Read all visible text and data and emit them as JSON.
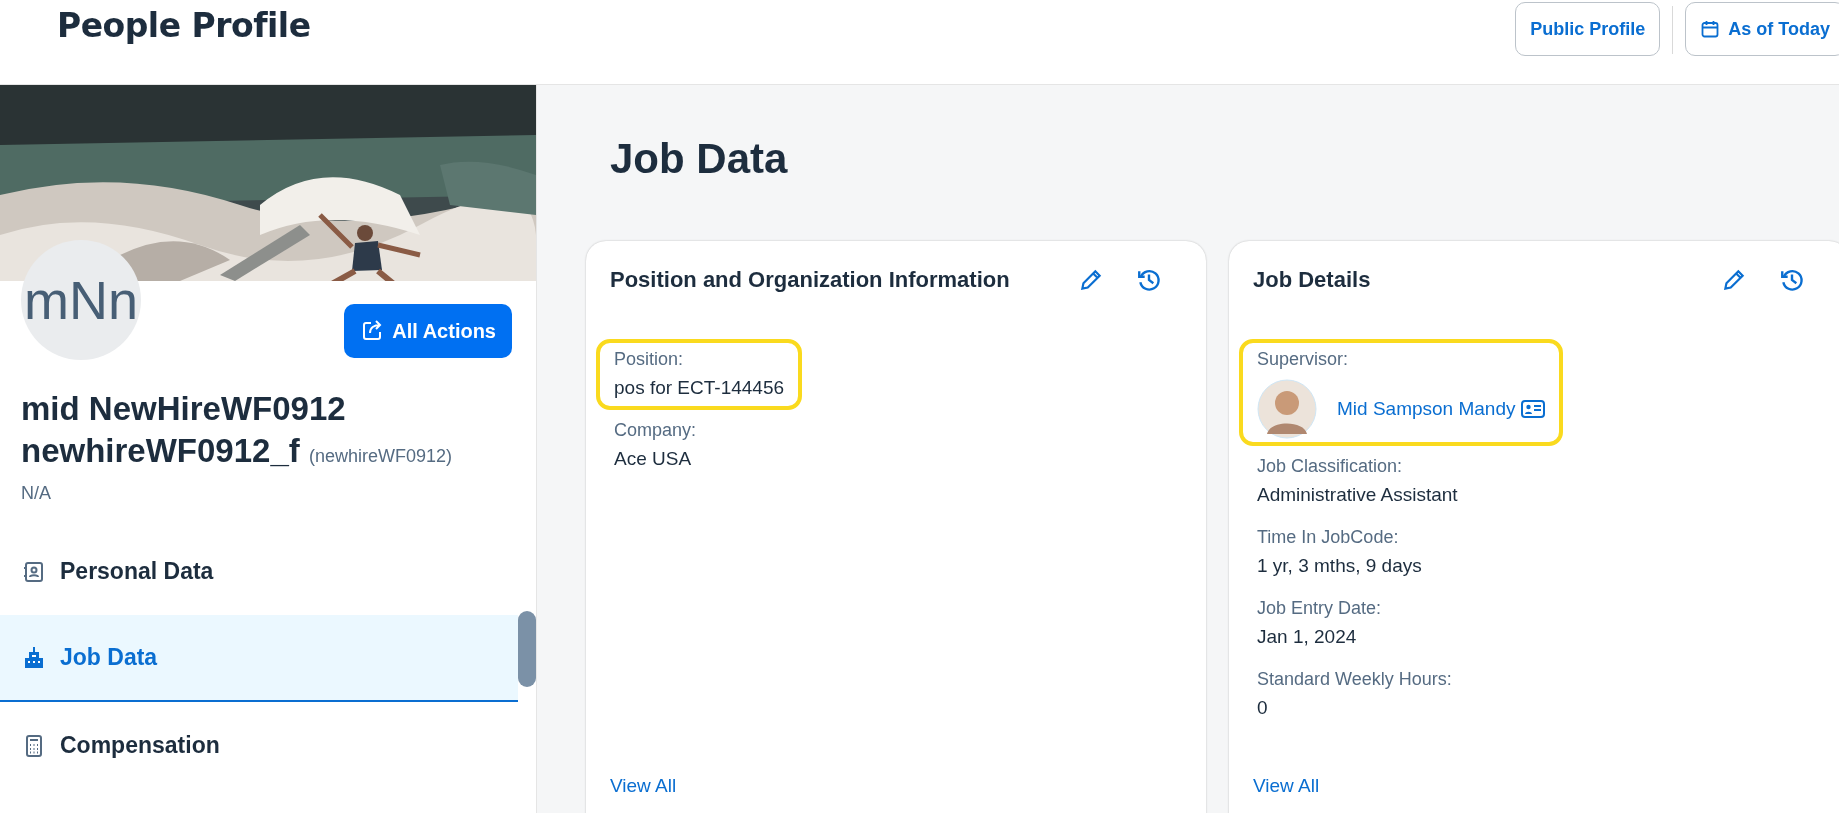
{
  "header": {
    "title": "People Profile",
    "buttons": [
      {
        "kind": "text",
        "label": "Public Profile"
      },
      {
        "kind": "calendar",
        "label": "As of Today"
      }
    ]
  },
  "profile": {
    "initials": "mNn",
    "actions_button": "All Actions",
    "name": "mid NewHireWF0912 newhireWF0912_f",
    "username": "(newhireWF0912)",
    "subtitle": "N/A"
  },
  "nav": [
    {
      "kind": "person-card",
      "label": "Personal Data",
      "selected": false
    },
    {
      "kind": "building",
      "label": "Job Data",
      "selected": true
    },
    {
      "kind": "calculator",
      "label": "Compensation",
      "selected": false
    }
  ],
  "page_title": "Job Data",
  "cards": [
    {
      "title": "Position and Organization Information",
      "fields": [
        {
          "kind": "text",
          "label": "Position:",
          "value": "pos for ECT-144456",
          "highlighted": true
        },
        {
          "kind": "text",
          "label": "Company:",
          "value": "Ace USA",
          "highlighted": false
        }
      ],
      "link": "View All"
    },
    {
      "title": "Job Details",
      "fields": [
        {
          "kind": "person",
          "label": "Supervisor:",
          "value": "Mid Sampson Mandy",
          "highlighted": true
        },
        {
          "kind": "text",
          "label": "Job Classification:",
          "value": "Administrative Assistant",
          "highlighted": false
        },
        {
          "kind": "text",
          "label": "Time In JobCode:",
          "value": "1 yr, 3 mths, 9 days",
          "highlighted": false
        },
        {
          "kind": "text",
          "label": "Job Entry Date:",
          "value": "Jan 1, 2024",
          "highlighted": false
        },
        {
          "kind": "text",
          "label": "Standard Weekly Hours:",
          "value": "0",
          "highlighted": false
        }
      ],
      "link": "View All"
    }
  ]
}
